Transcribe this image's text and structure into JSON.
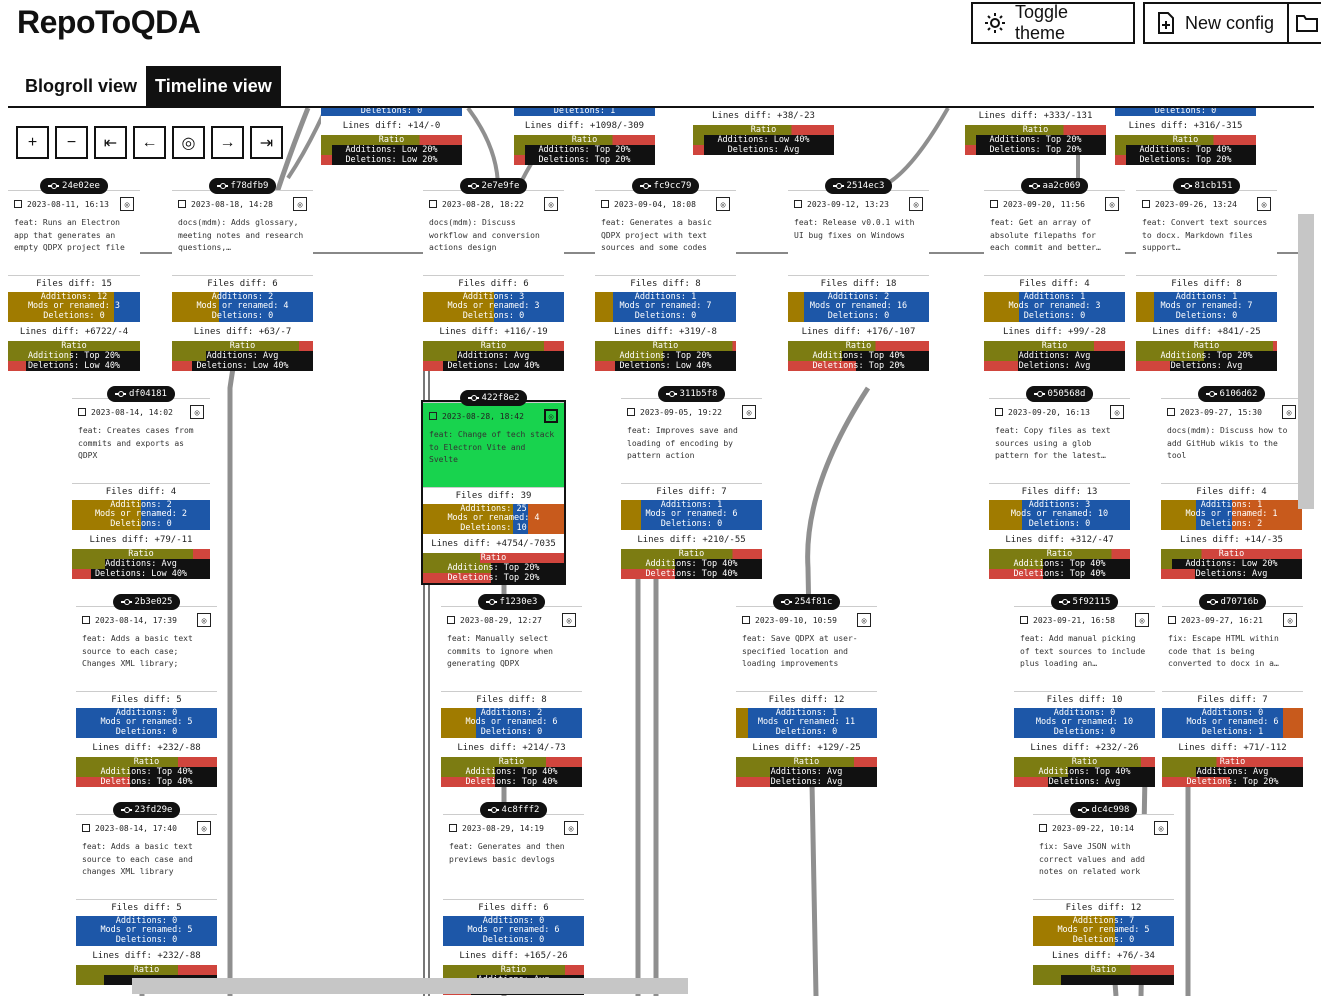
{
  "app": {
    "title": "RepoToQDA"
  },
  "header": {
    "toggle_theme": "Toggle theme",
    "new_config": "New config"
  },
  "tabs": [
    {
      "label": "Blogroll view",
      "active": false
    },
    {
      "label": "Timeline view",
      "active": true
    }
  ],
  "toolbar": {
    "zoom_in": "+",
    "zoom_out": "−",
    "first": "⇤",
    "prev": "←",
    "center": "◎",
    "next": "→",
    "last": "⇥"
  },
  "colors": {
    "additions": "#a07b00",
    "mods": "#1d57a8",
    "deletions": "#c85a1c",
    "olive": "#7c7c12",
    "red": "#d0453d",
    "selected": "#18d34e"
  },
  "ratio_label": "Ratio",
  "top_strips": [
    {
      "line1": "Deletions: 0",
      "lines": "Lines diff: +14/-0",
      "add": "Additions: Low 20%",
      "del": "Deletions: Low 20%"
    },
    {
      "line1": "Deletions: 1",
      "lines": "Lines diff: +1098/-309",
      "add": "Additions: Top 20%",
      "del": "Deletions: Top 20%"
    },
    {
      "line1": "",
      "lines": "Lines diff: +38/-23",
      "add": "Additions: Low 40%",
      "del": "Deletions: Avg"
    },
    {
      "line1": "",
      "lines": "Lines diff: +333/-131",
      "add": "Additions: Top 20%",
      "del": "Deletions: Top 20%"
    },
    {
      "line1": "Deletions: 0",
      "lines": "Lines diff: +316/-315",
      "add": "Additions: Top 40%",
      "del": "Deletions: Top 20%"
    }
  ],
  "commits": [
    {
      "hash": "24e02ee",
      "date": "2023-08-11, 16:13",
      "message": "feat: Runs an Electron app that generates an empty QDPX project file",
      "files": "Files diff: 15",
      "additions": "Additions: 12",
      "mods": "Mods or renamed: 3",
      "deletions": "Deletions: 0",
      "lines": "Lines diff: +6722/-4",
      "ratio_add": "Additions: Top 20%",
      "ratio_del": "Deletions: Low 40%"
    },
    {
      "hash": "f78dfb9",
      "date": "2023-08-18, 14:28",
      "message": "docs(mdm): Adds glossary, meeting notes and research questions,…",
      "files": "Files diff: 6",
      "additions": "Additions: 2",
      "mods": "Mods or renamed: 4",
      "deletions": "Deletions: 0",
      "lines": "Lines diff: +63/-7",
      "ratio_add": "Additions: Avg",
      "ratio_del": "Deletions: Low 40%"
    },
    {
      "hash": "2e7e9fe",
      "date": "2023-08-28, 18:22",
      "message": "docs(mdm): Discuss workflow and conversion actions design",
      "files": "Files diff: 6",
      "additions": "Additions: 3",
      "mods": "Mods or renamed: 3",
      "deletions": "Deletions: 0",
      "lines": "Lines diff: +116/-19",
      "ratio_add": "Additions: Avg",
      "ratio_del": "Deletions: Low 40%"
    },
    {
      "hash": "fc9cc79",
      "date": "2023-09-04, 18:08",
      "message": "feat: Generates a basic QDPX project with text sources and some codes",
      "files": "Files diff: 8",
      "additions": "Additions: 1",
      "mods": "Mods or renamed: 7",
      "deletions": "Deletions: 0",
      "lines": "Lines diff: +319/-8",
      "ratio_add": "Additions: Top 20%",
      "ratio_del": "Deletions: Low 40%"
    },
    {
      "hash": "2514ec3",
      "date": "2023-09-12, 13:23",
      "message": "feat: Release v0.0.1 with UI bug fixes on Windows",
      "files": "Files diff: 18",
      "additions": "Additions: 2",
      "mods": "Mods or renamed: 16",
      "deletions": "Deletions: 0",
      "lines": "Lines diff: +176/-107",
      "ratio_add": "Additions: Top 40%",
      "ratio_del": "Deletions: Top 20%"
    },
    {
      "hash": "aa2c069",
      "date": "2023-09-20, 11:56",
      "message": "feat: Get an array of absolute filepaths for each commit and better…",
      "files": "Files diff: 4",
      "additions": "Additions: 1",
      "mods": "Mods or renamed: 3",
      "deletions": "Deletions: 0",
      "lines": "Lines diff: +99/-28",
      "ratio_add": "Additions: Avg",
      "ratio_del": "Deletions: Avg"
    },
    {
      "hash": "81cb151",
      "date": "2023-09-26, 13:24",
      "message": "feat: Convert text sources to docx. Markdown files support…",
      "files": "Files diff: 8",
      "additions": "Additions: 1",
      "mods": "Mods or renamed: 7",
      "deletions": "Deletions: 0",
      "lines": "Lines diff: +841/-25",
      "ratio_add": "Additions: Top 20%",
      "ratio_del": "Deletions: Avg"
    },
    {
      "hash": "df04181",
      "date": "2023-08-14, 14:02",
      "message": "feat: Creates cases from commits and exports as QDPX",
      "files": "Files diff: 4",
      "additions": "Additions: 2",
      "mods": "Mods or renamed: 2",
      "deletions": "Deletions: 0",
      "lines": "Lines diff: +79/-11",
      "ratio_add": "Additions: Avg",
      "ratio_del": "Deletions: Low 40%"
    },
    {
      "hash": "422f8e2",
      "date": "2023-08-28, 18:42",
      "message": "feat: Change of tech stack to Electron Vite and Svelte",
      "files": "Files diff: 39",
      "additions": "Additions: 25",
      "mods": "Mods or renamed: 4",
      "deletions": "Deletions: 10",
      "lines": "Lines diff: +4754/-7035",
      "ratio_add": "Additions: Top 20%",
      "ratio_del": "Deletions: Top 20%"
    },
    {
      "hash": "311b5f8",
      "date": "2023-09-05, 19:22",
      "message": "feat: Improves save and loading of encoding by pattern action",
      "files": "Files diff: 7",
      "additions": "Additions: 1",
      "mods": "Mods or renamed: 6",
      "deletions": "Deletions: 0",
      "lines": "Lines diff: +210/-55",
      "ratio_add": "Additions: Top 40%",
      "ratio_del": "Deletions: Top 40%"
    },
    {
      "hash": "050568d",
      "date": "2023-09-20, 16:13",
      "message": "feat: Copy files as text sources using a glob pattern for the latest…",
      "files": "Files diff: 13",
      "additions": "Additions: 3",
      "mods": "Mods or renamed: 10",
      "deletions": "Deletions: 0",
      "lines": "Lines diff: +312/-47",
      "ratio_add": "Additions: Top 40%",
      "ratio_del": "Deletions: Top 40%"
    },
    {
      "hash": "6106d62",
      "date": "2023-09-27, 15:30",
      "message": "docs(mdm): Discuss how to add GitHub wikis to the tool",
      "files": "Files diff: 4",
      "additions": "Additions: 1",
      "mods": "Mods or renamed: 1",
      "deletions": "Deletions: 2",
      "lines": "Lines diff: +14/-35",
      "ratio_add": "Additions: Low 20%",
      "ratio_del": "Deletions: Avg"
    },
    {
      "hash": "2b3e025",
      "date": "2023-08-14, 17:39",
      "message": "feat: Adds a basic text source to each case; Changes XML library;",
      "files": "Files diff: 5",
      "additions": "Additions: 0",
      "mods": "Mods or renamed: 5",
      "deletions": "Deletions: 0",
      "lines": "Lines diff: +232/-88",
      "ratio_add": "Additions: Top 40%",
      "ratio_del": "Deletions: Top 40%"
    },
    {
      "hash": "f1230e3",
      "date": "2023-08-29, 12:27",
      "message": "feat: Manually select commits to ignore when generating QDPX",
      "files": "Files diff: 8",
      "additions": "Additions: 2",
      "mods": "Mods or renamed: 6",
      "deletions": "Deletions: 0",
      "lines": "Lines diff: +214/-73",
      "ratio_add": "Additions: Top 40%",
      "ratio_del": "Deletions: Top 40%"
    },
    {
      "hash": "254f81c",
      "date": "2023-09-10, 10:59",
      "message": "feat: Save QDPX at user-specified location and loading improvements",
      "files": "Files diff: 12",
      "additions": "Additions: 1",
      "mods": "Mods or renamed: 11",
      "deletions": "Deletions: 0",
      "lines": "Lines diff: +129/-25",
      "ratio_add": "Additions: Avg",
      "ratio_del": "Deletions: Avg"
    },
    {
      "hash": "5f92115",
      "date": "2023-09-21, 16:58",
      "message": "feat: Add manual picking of text sources to include plus loading an…",
      "files": "Files diff: 10",
      "additions": "Additions: 0",
      "mods": "Mods or renamed: 10",
      "deletions": "Deletions: 0",
      "lines": "Lines diff: +232/-26",
      "ratio_add": "Additions: Top 40%",
      "ratio_del": "Deletions: Avg"
    },
    {
      "hash": "d70716b",
      "date": "2023-09-27, 16:21",
      "message": "fix: Escape HTML within code that is being converted to docx in a…",
      "files": "Files diff: 7",
      "additions": "Additions: 0",
      "mods": "Mods or renamed: 6",
      "deletions": "Deletions: 1",
      "lines": "Lines diff: +71/-112",
      "ratio_add": "Additions: Avg",
      "ratio_del": "Deletions: Top 20%"
    },
    {
      "hash": "23fd29e",
      "date": "2023-08-14, 17:40",
      "message": "feat: Adds a basic text source to each case and changes XML library",
      "files": "Files diff: 5",
      "additions": "Additions: 0",
      "mods": "Mods or renamed: 5",
      "deletions": "Deletions: 0",
      "lines": "Lines diff: +232/-88",
      "ratio_add": "",
      "ratio_del": ""
    },
    {
      "hash": "4c8fff2",
      "date": "2023-08-29, 14:19",
      "message": "feat: Generates and then previews basic devlogs",
      "files": "Files diff: 6",
      "additions": "Additions: 0",
      "mods": "Mods or renamed: 6",
      "deletions": "Deletions: 0",
      "lines": "Lines diff: +165/-26",
      "ratio_add": "Additions: Avg",
      "ratio_del": ""
    },
    {
      "hash": "dc4c998",
      "date": "2023-09-22, 10:14",
      "message": "fix: Save JSON with correct values and add notes on related work",
      "files": "Files diff: 12",
      "additions": "Additions: 7",
      "mods": "Mods or renamed: 5",
      "deletions": "Deletions: 0",
      "lines": "Lines diff: +76/-34",
      "ratio_add": "",
      "ratio_del": ""
    }
  ]
}
